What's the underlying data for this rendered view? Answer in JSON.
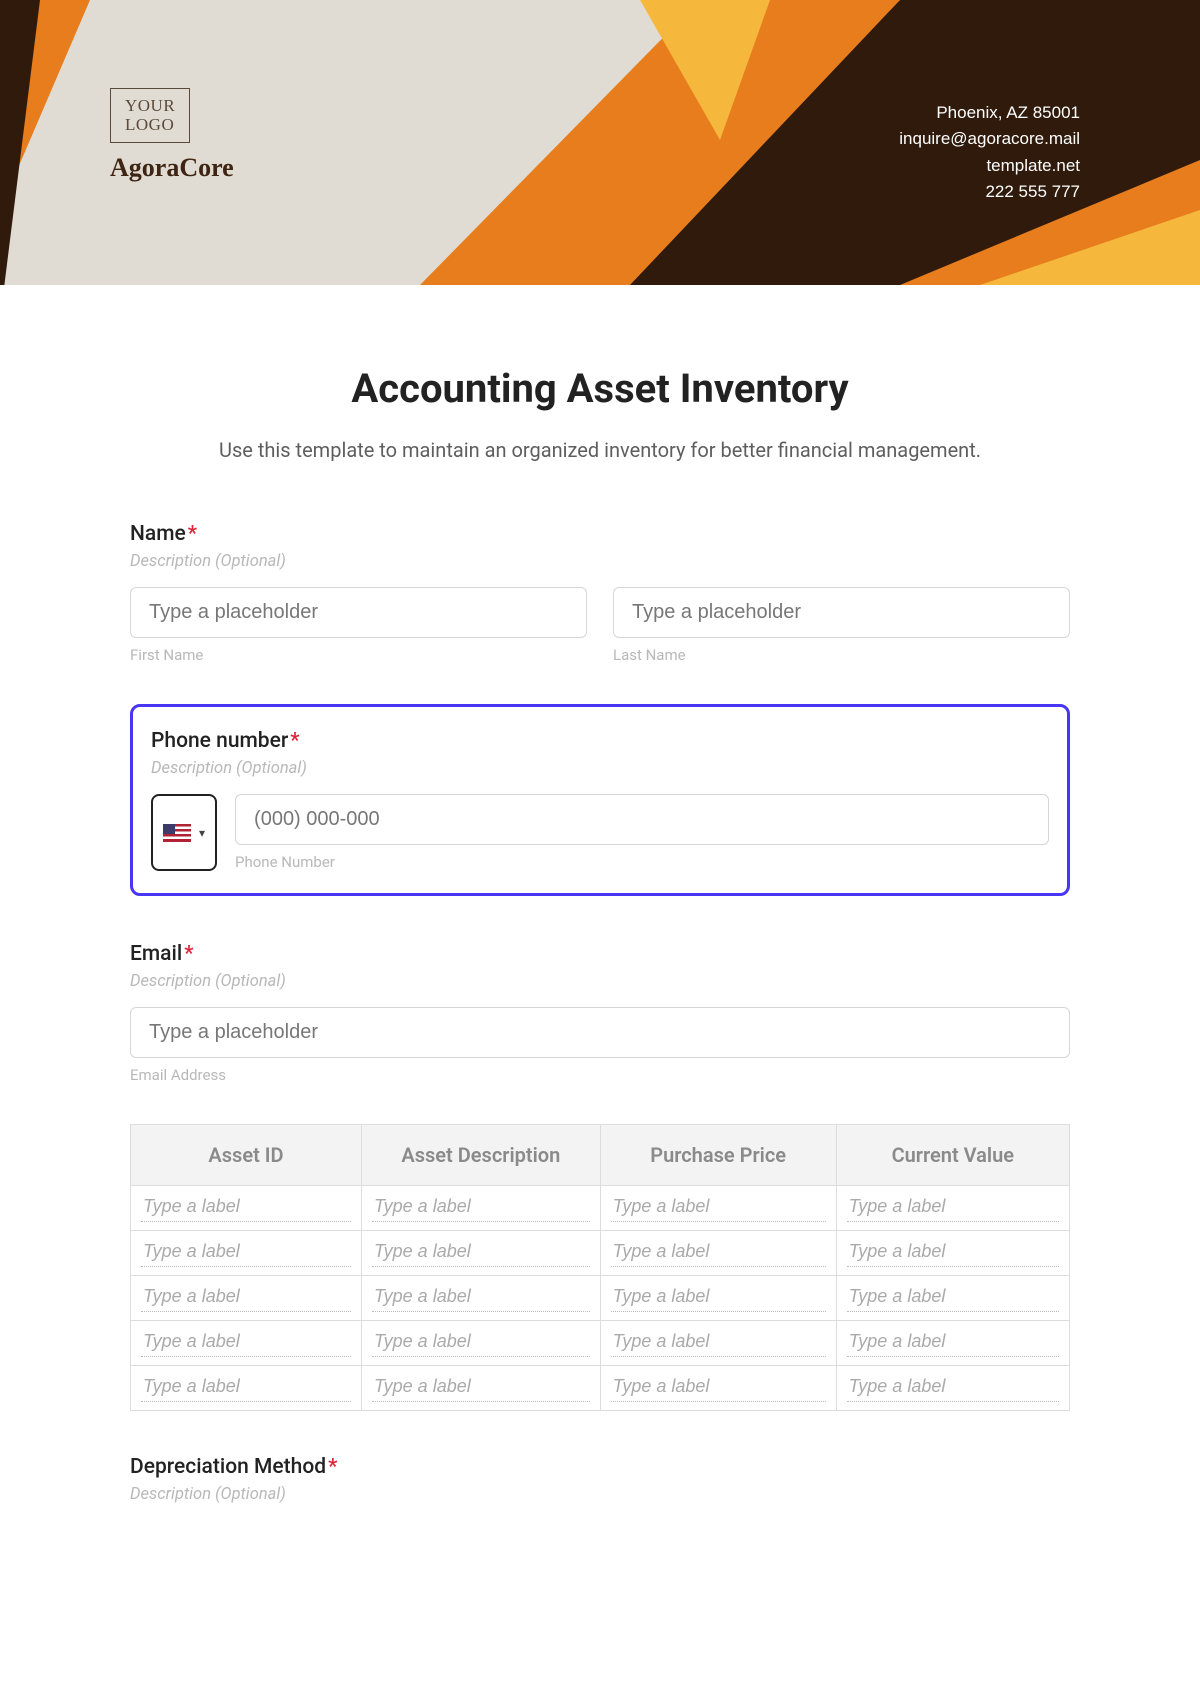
{
  "header": {
    "logo_line1": "YOUR",
    "logo_line2": "LOGO",
    "brand": "AgoraCore",
    "contact": {
      "address": "Phoenix, AZ 85001",
      "email": "inquire@agoracore.mail",
      "site": "template.net",
      "phone": "222 555 777"
    }
  },
  "page": {
    "title": "Accounting Asset Inventory",
    "subtitle": "Use this template to maintain an organized inventory for better financial management."
  },
  "name": {
    "label": "Name",
    "desc": "Description (Optional)",
    "first_placeholder": "Type a placeholder",
    "last_placeholder": "Type a placeholder",
    "first_sub": "First Name",
    "last_sub": "Last Name"
  },
  "phone": {
    "label": "Phone number",
    "desc": "Description (Optional)",
    "placeholder": "(000) 000-000",
    "sub": "Phone Number"
  },
  "email": {
    "label": "Email",
    "desc": "Description (Optional)",
    "placeholder": "Type a placeholder",
    "sub": "Email Address"
  },
  "table": {
    "headers": [
      "Asset ID",
      "Asset Description",
      "Purchase Price",
      "Current Value"
    ],
    "cell_placeholder": "Type a label",
    "rows": 5,
    "cols": 4
  },
  "depreciation": {
    "label": "Depreciation Method",
    "desc": "Description (Optional)"
  },
  "required_mark": "*"
}
